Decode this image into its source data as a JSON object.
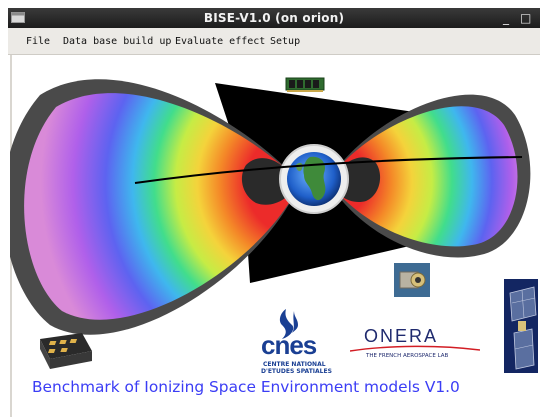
{
  "window": {
    "title": "BISE-V1.0 (on orion)",
    "minimize_glyph": "_",
    "close_glyph": "□"
  },
  "menu": {
    "items": [
      {
        "label": "File"
      },
      {
        "label": "Data base build up"
      },
      {
        "label": "Evaluate effect"
      },
      {
        "label": "Setup"
      }
    ]
  },
  "illustration": {
    "subject": "Earth radiation belts",
    "colors": {
      "outer_belt": "#4a4a4a",
      "belt_bands": [
        "#d98ad8",
        "#b060ea",
        "#5d63f0",
        "#3fb7ee",
        "#41dd8c",
        "#c6ec45",
        "#f4d33b",
        "#f48a28",
        "#ec2b2a"
      ],
      "orbit_line": "#000000"
    }
  },
  "logos": {
    "cnes": {
      "wordmark": "cnes",
      "line1": "CENTRE NATIONAL",
      "line2": "D'ETUDES SPATIALES",
      "color": "#1a3f93"
    },
    "onera": {
      "wordmark": "ONERA",
      "tagline": "THE FRENCH AEROSPACE LAB",
      "color": "#1f2a6e"
    }
  },
  "caption": {
    "text": "Benchmark of Ionizing Space Environment models V1.0",
    "color": "#3b3df5"
  }
}
